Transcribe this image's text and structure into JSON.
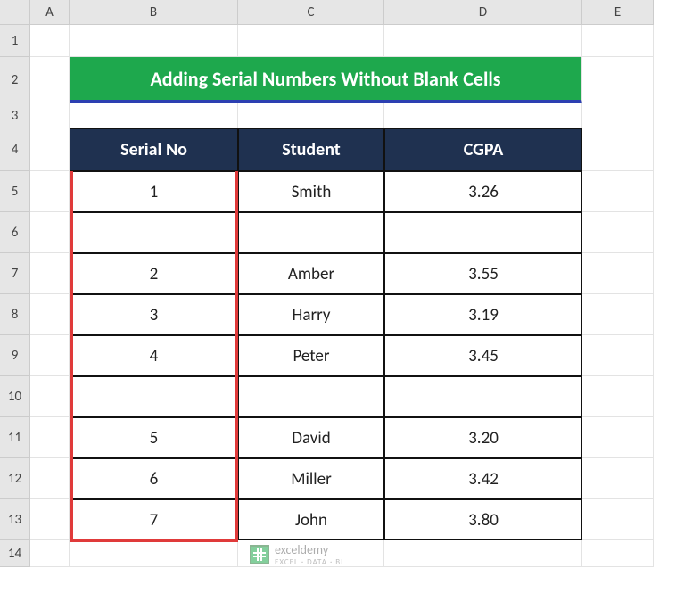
{
  "columns": [
    "",
    "A",
    "B",
    "C",
    "D",
    "E"
  ],
  "rows": [
    "",
    "1",
    "2",
    "3",
    "4",
    "5",
    "6",
    "7",
    "8",
    "9",
    "10",
    "11",
    "12",
    "13",
    "14"
  ],
  "title": "Adding Serial Numbers Without Blank Cells",
  "headers": {
    "serial": "Serial No",
    "student": "Student",
    "cgpa": "CGPA"
  },
  "data_rows": [
    {
      "serial": "1",
      "student": "Smith",
      "cgpa": "3.26"
    },
    {
      "serial": "",
      "student": "",
      "cgpa": ""
    },
    {
      "serial": "2",
      "student": "Amber",
      "cgpa": "3.55"
    },
    {
      "serial": "3",
      "student": "Harry",
      "cgpa": "3.19"
    },
    {
      "serial": "4",
      "student": "Peter",
      "cgpa": "3.45"
    },
    {
      "serial": "",
      "student": "",
      "cgpa": ""
    },
    {
      "serial": "5",
      "student": "David",
      "cgpa": "3.20"
    },
    {
      "serial": "6",
      "student": "Miller",
      "cgpa": "3.42"
    },
    {
      "serial": "7",
      "student": "John",
      "cgpa": "3.80"
    }
  ],
  "watermark": {
    "name": "exceldemy",
    "sub": "EXCEL · DATA · BI"
  },
  "chart_data": {
    "type": "table",
    "title": "Adding Serial Numbers Without Blank Cells",
    "columns": [
      "Serial No",
      "Student",
      "CGPA"
    ],
    "rows": [
      [
        1,
        "Smith",
        3.26
      ],
      [
        null,
        null,
        null
      ],
      [
        2,
        "Amber",
        3.55
      ],
      [
        3,
        "Harry",
        3.19
      ],
      [
        4,
        "Peter",
        3.45
      ],
      [
        null,
        null,
        null
      ],
      [
        5,
        "David",
        3.2
      ],
      [
        6,
        "Miller",
        3.42
      ],
      [
        7,
        "John",
        3.8
      ]
    ]
  }
}
